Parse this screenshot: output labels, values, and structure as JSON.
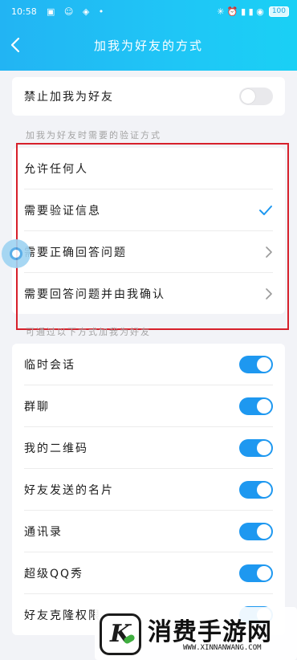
{
  "status_bar": {
    "time": "10:58",
    "left_icons": "▣ ☺ ◈ •",
    "right_icons": "✳ ⏰ ▮ ▮ ◉",
    "battery": "100"
  },
  "nav": {
    "title": "加我为好友的方式"
  },
  "block_friend": {
    "label": "禁止加我为好友",
    "enabled": false
  },
  "verification": {
    "section_label": "加我为好友时需要的验证方式",
    "options": [
      {
        "label": "允许任何人",
        "indicator": "none"
      },
      {
        "label": "需要验证信息",
        "indicator": "check"
      },
      {
        "label": "需要正确回答问题",
        "indicator": "chevron"
      },
      {
        "label": "需要回答问题并由我确认",
        "indicator": "chevron"
      }
    ]
  },
  "sources": {
    "section_label": "可通过以下方式加我为好友",
    "items": [
      {
        "label": "临时会话",
        "enabled": true
      },
      {
        "label": "群聊",
        "enabled": true
      },
      {
        "label": "我的二维码",
        "enabled": true
      },
      {
        "label": "好友发送的名片",
        "enabled": true
      },
      {
        "label": "通讯录",
        "enabled": true
      },
      {
        "label": "超级QQ秀",
        "enabled": true
      },
      {
        "label": "好友克隆权限",
        "enabled": true
      }
    ]
  },
  "watermark": {
    "logo_letter": "K",
    "name": "消费手游网",
    "url": "WWW.XINNANWANG.COM"
  },
  "colors": {
    "header_gradient_start": "#22b4f3",
    "header_gradient_end": "#1ad0f5",
    "toggle_on": "#1e98f0",
    "highlight_box": "#d7202b",
    "check": "#1e98f0"
  }
}
